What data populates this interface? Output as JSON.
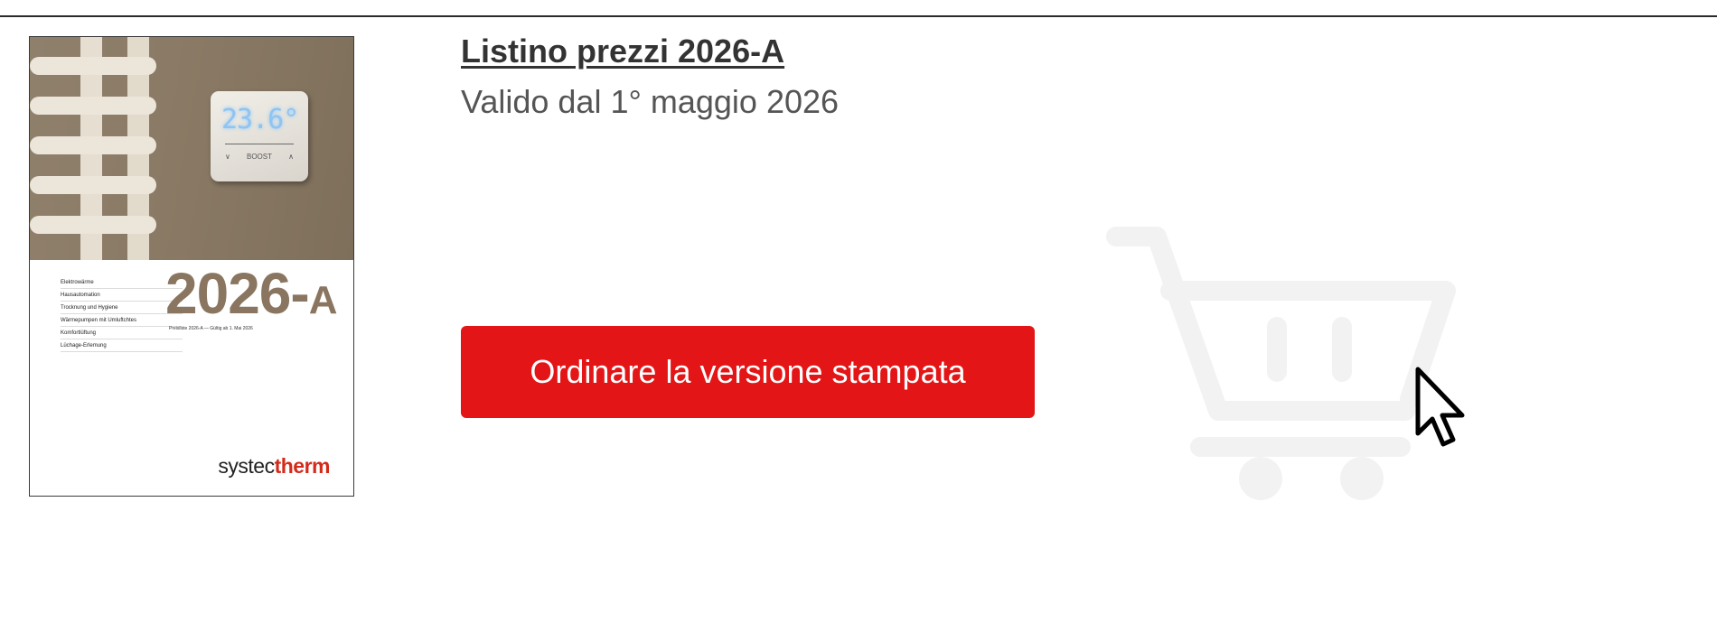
{
  "catalog_cover": {
    "thermostat_display": "23.6°",
    "thermostat_boost_label": "BOOST",
    "nav_items": [
      "Elektrowärme",
      "Hausautomation",
      "Trocknung und Hygiene",
      "Wärmepumpen mit Umluftchtes",
      "Komfortlüftung",
      "Lüchage-Erlemung"
    ],
    "year": "2026-",
    "year_suffix": "A",
    "subtitle": "Preisliste 2026-A — Gültig ab 1. Mai 2026",
    "brand_prefix": "systec",
    "brand_accent": "therm"
  },
  "price_list": {
    "title": "Listino prezzi 2026-A",
    "valid_from": "Valido dal 1° maggio 2026"
  },
  "order_button": {
    "label": "Ordinare la versione stampata"
  },
  "icons": {
    "cart": "shopping-cart-icon",
    "cursor": "mouse-pointer-icon"
  },
  "colors": {
    "accent": "#e31516",
    "brand_red": "#d42a1a",
    "cover_brown": "#8a7560",
    "cart_gray": "#f2f2f2"
  }
}
